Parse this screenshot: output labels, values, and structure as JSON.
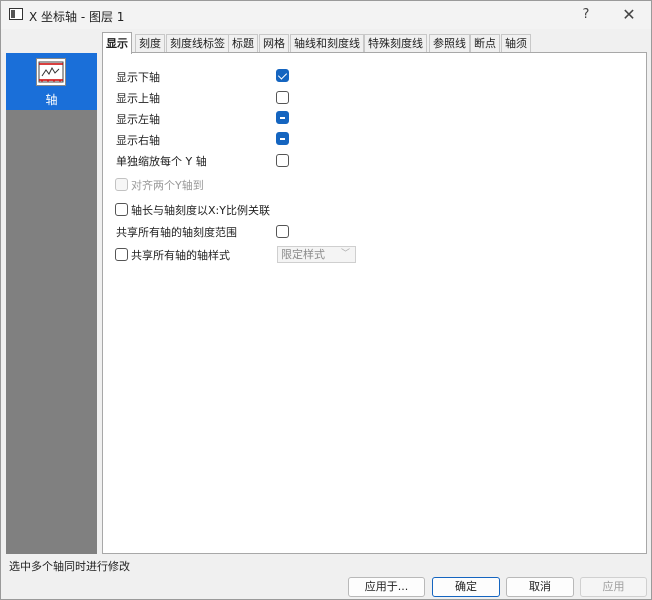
{
  "window": {
    "title": "X 坐标轴 - 图层 1",
    "help": "?",
    "close": "✕"
  },
  "sidebar": {
    "items": [
      {
        "label": "轴",
        "icon": "axis-chart-icon",
        "selected": true
      }
    ]
  },
  "tabs": [
    {
      "label": "显示",
      "active": true
    },
    {
      "label": "刻度"
    },
    {
      "label": "刻度线标签"
    },
    {
      "label": "标题"
    },
    {
      "label": "网格"
    },
    {
      "label": "轴线和刻度线"
    },
    {
      "label": "特殊刻度线"
    },
    {
      "label": "参照线"
    },
    {
      "label": "断点"
    },
    {
      "label": "轴须"
    }
  ],
  "display": {
    "show_bottom": {
      "label": "显示下轴",
      "state": "checked"
    },
    "show_top": {
      "label": "显示上轴",
      "state": "unchecked"
    },
    "show_left": {
      "label": "显示左轴",
      "state": "indeterminate"
    },
    "show_right": {
      "label": "显示右轴",
      "state": "indeterminate"
    },
    "rescale_each_y": {
      "label": "单独缩放每个 Y 轴",
      "state": "unchecked"
    },
    "align_two_y": {
      "label": "对齐两个Y轴到",
      "state": "disabled"
    },
    "link_axis_length": {
      "label": "轴长与轴刻度以X:Y比例关联",
      "state": "unchecked"
    },
    "share_scale_range": {
      "label": "共享所有轴的轴刻度范围",
      "state": "unchecked"
    },
    "share_axis_style": {
      "label": "共享所有轴的轴样式",
      "state": "unchecked"
    },
    "style_select": {
      "value": "限定样式"
    }
  },
  "status": "选中多个轴同时进行修改",
  "buttons": {
    "apply_to": "应用于...",
    "ok": "确定",
    "cancel": "取消",
    "apply": "应用"
  },
  "colors": {
    "accent": "#1565c0",
    "sidebar_bg": "#808080",
    "selected_item": "#1a6fd9"
  }
}
